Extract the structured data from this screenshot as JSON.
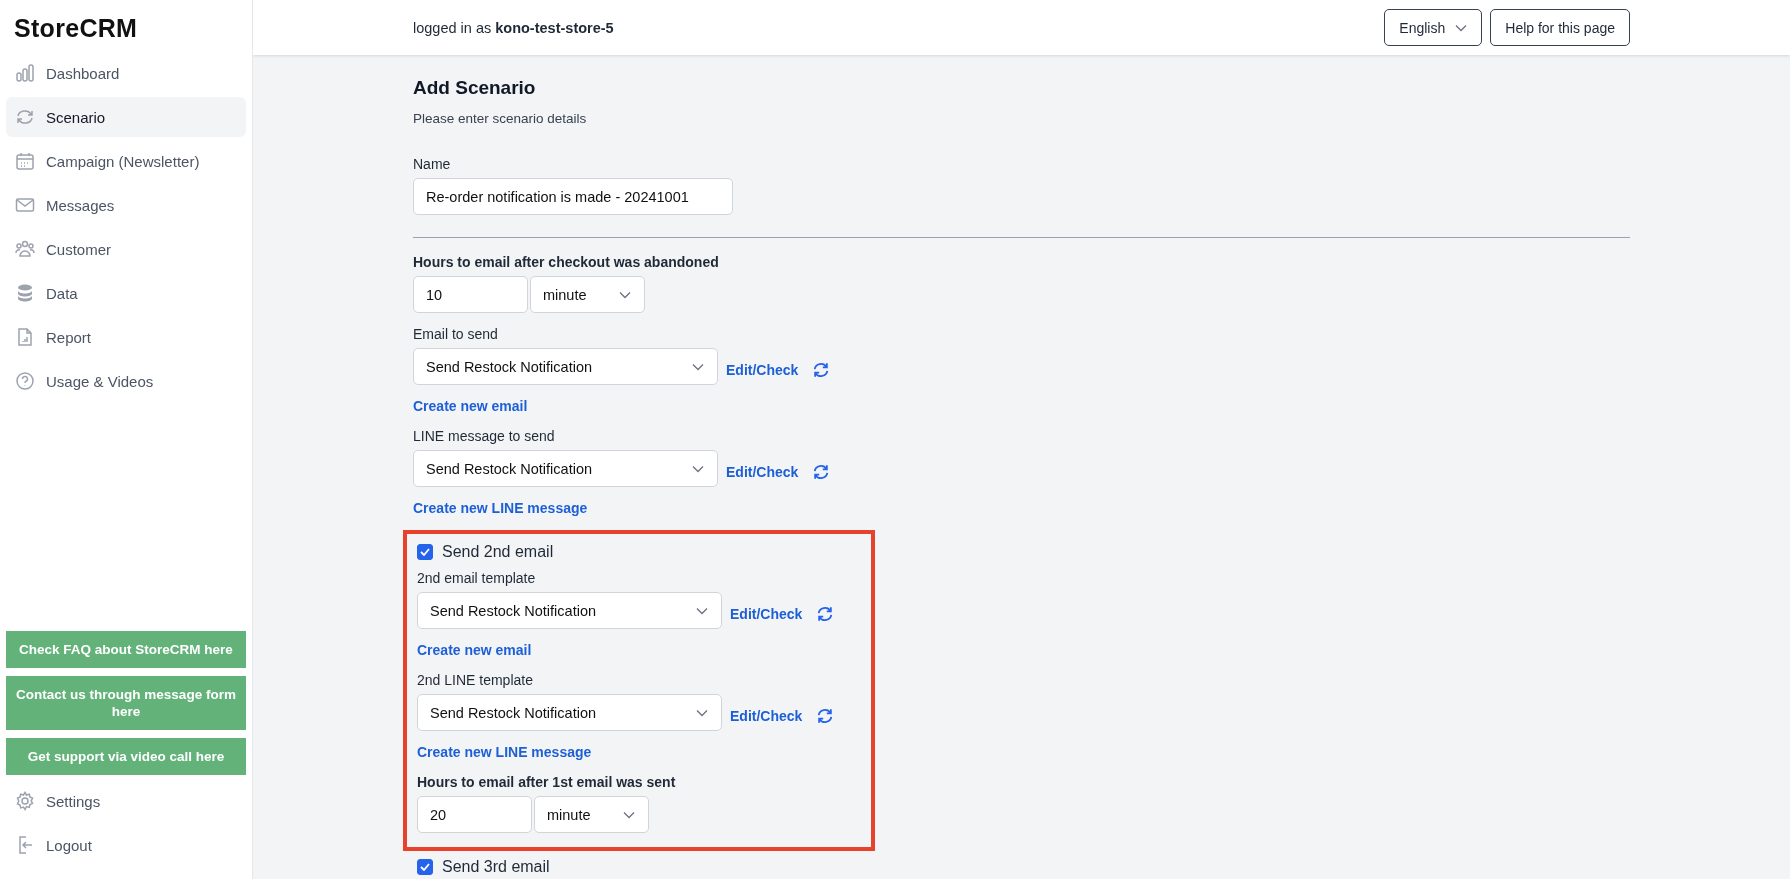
{
  "sidebar": {
    "logo": "StoreCRM",
    "items": [
      {
        "label": "Dashboard",
        "selected": false
      },
      {
        "label": "Scenario",
        "selected": true
      },
      {
        "label": "Campaign (Newsletter)",
        "selected": false
      },
      {
        "label": "Messages",
        "selected": false
      },
      {
        "label": "Customer",
        "selected": false
      },
      {
        "label": "Data",
        "selected": false
      },
      {
        "label": "Report",
        "selected": false
      },
      {
        "label": "Usage & Videos",
        "selected": false
      }
    ],
    "help_buttons": [
      "Check FAQ about StoreCRM here",
      "Contact us through message form here",
      "Get support via video call here"
    ],
    "footer_items": [
      {
        "label": "Settings"
      },
      {
        "label": "Logout"
      }
    ]
  },
  "header": {
    "login_prefix": "logged in as",
    "username": "kono-test-store-5",
    "language": "English",
    "help_button": "Help for this page"
  },
  "form": {
    "title": "Add Scenario",
    "subtitle": "Please enter scenario details",
    "name_label": "Name",
    "name_value": "Re-order notification is made - 20241001",
    "sections": [
      {
        "kind": "duration",
        "label": "Hours to email after checkout was abandoned",
        "value": "10",
        "unit": "minute"
      },
      {
        "kind": "template",
        "label": "Email to send",
        "value": "Send Restock Notification",
        "action": "Edit/Check",
        "create_link": "Create new email"
      },
      {
        "kind": "template",
        "label": "LINE message to send",
        "value": "Send Restock Notification",
        "action": "Edit/Check",
        "create_link": "Create new LINE message"
      }
    ],
    "steps": [
      {
        "label": "Send 2nd email",
        "checked": true,
        "highlighted": true,
        "sections": [
          {
            "kind": "template",
            "label": "2nd email template",
            "value": "Send Restock Notification",
            "action": "Edit/Check",
            "create_link": "Create new email"
          },
          {
            "kind": "template",
            "label": "2nd LINE template",
            "value": "Send Restock Notification",
            "action": "Edit/Check",
            "create_link": "Create new LINE message"
          },
          {
            "kind": "duration",
            "label": "Hours to email after 1st email was sent",
            "value": "20",
            "unit": "minute"
          }
        ]
      },
      {
        "label": "Send 3rd email",
        "checked": true,
        "highlighted": false
      }
    ]
  }
}
